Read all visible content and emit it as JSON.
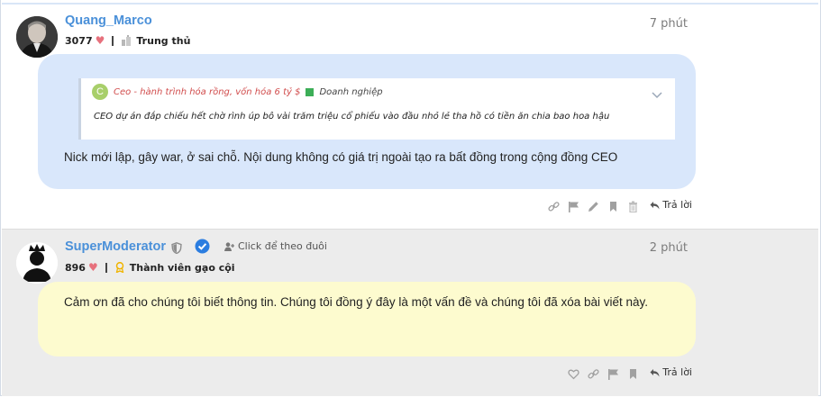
{
  "posts": [
    {
      "username": "Quang_Marco",
      "points": "3077",
      "rank": "Trung thủ",
      "time": "7 phút",
      "quote": {
        "avatar_letter": "C",
        "title": "Ceo - hành trình hóa rồng, vốn hóa 6 tỷ $",
        "category": "Doanh nghiệp",
        "text": "CEO dự án đắp chiếu hết chờ rình úp bô vài trăm triệu cổ phiếu vào đầu nhỏ lẻ tha hồ có tiền ăn chia bao hoa hậu"
      },
      "message": "Nick mới lập, gây war, ở sai chỗ. Nội dung không có giá trị ngoài tạo ra bất đồng trong cộng đồng CEO",
      "reply_label": "Trả lời"
    },
    {
      "username": "SuperModerator",
      "follow_label": "Click để theo đuôi",
      "points": "896",
      "rank": "Thành viên gạo cội",
      "time": "2 phút",
      "message": "Cảm ơn đã cho chúng tôi biết thông tin. Chúng tôi đồng ý đây là một vấn đề và chúng tôi đã xóa bài viết này.",
      "reply_label": "Trả lời"
    }
  ],
  "colors": {
    "username": "#4a90d9",
    "bubble_user": "#d9e7fb",
    "bubble_mod": "#fdfbcf",
    "moderator_row": "#ececec",
    "quote_title": "#d14d4d"
  },
  "icons": {
    "post_1_actions": [
      "link-icon",
      "flag-icon",
      "edit-icon",
      "bookmark-icon",
      "trash-icon",
      "reply-icon"
    ],
    "post_2_actions": [
      "heart-outline-icon",
      "link-icon",
      "flag-icon",
      "bookmark-icon",
      "reply-icon"
    ]
  }
}
